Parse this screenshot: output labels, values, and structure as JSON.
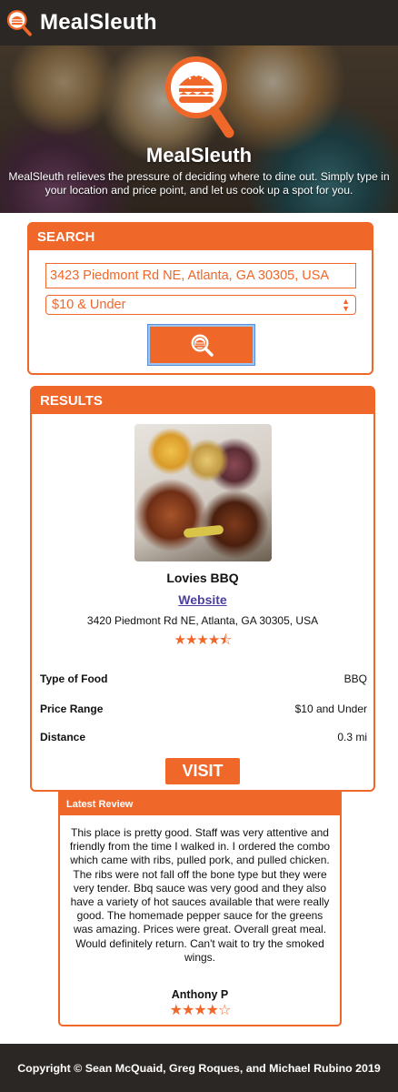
{
  "app": {
    "brand_name": "MealSleuth"
  },
  "hero": {
    "title": "MealSleuth",
    "description": "MealSleuth relieves the pressure of deciding where to dine out. Simply type in your location and price point, and let us cook up a spot for you."
  },
  "search": {
    "heading": "SEARCH",
    "address_value": "3423 Piedmont Rd NE, Atlanta, GA 30305, USA",
    "price_selected": "$10 & Under",
    "search_icon": "magnifier-burger-icon"
  },
  "results": {
    "heading": "RESULTS",
    "restaurant": {
      "name": "Lovies BBQ",
      "website_label": "Website",
      "address": "3420 Piedmont Rd NE, Atlanta, GA 30305, USA",
      "rating": 4.5,
      "stars": "★★★★⯪"
    },
    "details": [
      {
        "label": "Type of Food",
        "value": "BBQ"
      },
      {
        "label": "Price Range",
        "value": "$10 and Under"
      },
      {
        "label": "Distance",
        "value": "0.3 mi"
      }
    ],
    "visit_label": "VISIT"
  },
  "review": {
    "heading": "Latest Review",
    "text": "This place is pretty good. Staff was very attentive and friendly from the time I walked in. I ordered the combo which came with ribs, pulled pork, and pulled chicken. The ribs were not fall off the bone type but they were very tender. Bbq sauce was very good and they also have a variety of hot sauces available that were really good. The homemade pepper sauce for the greens was amazing. Prices were great. Overall great meal. Would definitely return. Can't wait to try the smoked wings.",
    "author": "Anthony P",
    "rating": 4,
    "stars": "★★★★☆"
  },
  "footer": {
    "copyright": "Copyright © Sean McQuaid, Greg Roques, and Michael Rubino 2019"
  },
  "colors": {
    "accent": "#f0672a",
    "header_bg": "#2b2724",
    "link": "#4b3fa0"
  }
}
